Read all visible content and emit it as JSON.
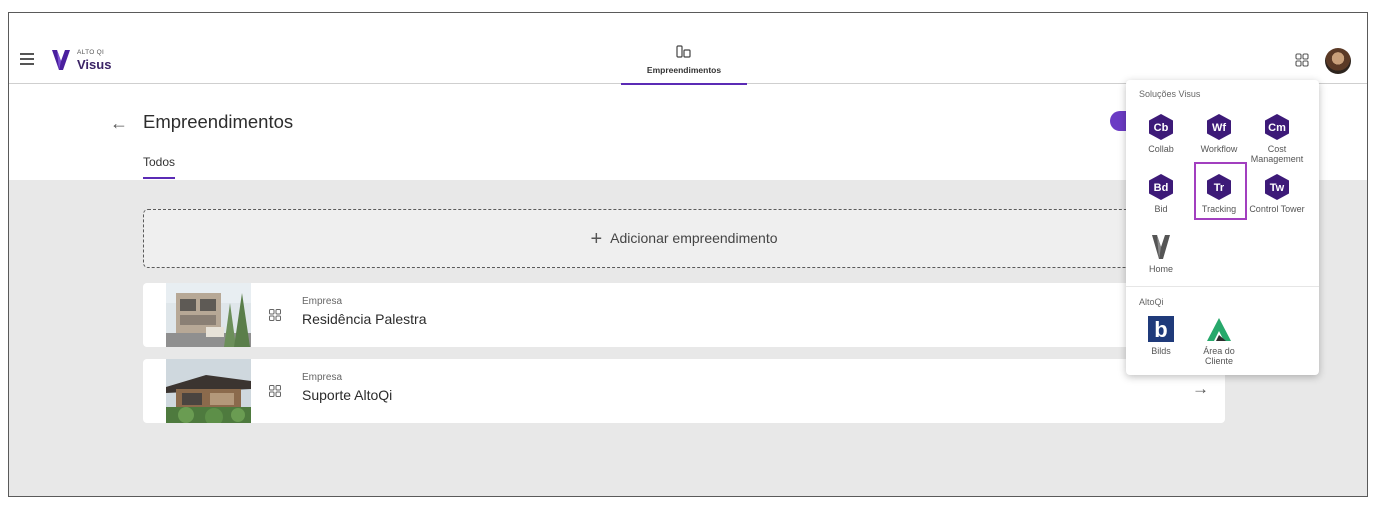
{
  "header": {
    "brand_small": "ALTO QI",
    "brand": "Visus",
    "nav_tab": "Empreendimentos"
  },
  "page": {
    "title": "Empreendimentos",
    "tab": "Todos"
  },
  "add_button_label": "Adicionar empreendimento",
  "projects": [
    {
      "label": "Empresa",
      "name": "Residência Palestra"
    },
    {
      "label": "Empresa",
      "name": "Suporte AltoQi"
    }
  ],
  "dropdown": {
    "section1": "Soluções Visus",
    "apps": [
      {
        "abbr": "Cb",
        "label": "Collab"
      },
      {
        "abbr": "Wf",
        "label": "Workflow"
      },
      {
        "abbr": "Cm",
        "label": "Cost Management"
      },
      {
        "abbr": "Bd",
        "label": "Bid"
      },
      {
        "abbr": "Tr",
        "label": "Tracking"
      },
      {
        "abbr": "Tw",
        "label": "Control Tower"
      },
      {
        "abbr": "",
        "label": "Home"
      }
    ],
    "section2": "AltoQi",
    "altoqi_apps": [
      {
        "abbr": "b",
        "label": "Bilds"
      },
      {
        "abbr": "",
        "label": "Área do Cliente"
      }
    ]
  },
  "colors": {
    "accent": "#5b2bb5",
    "hex_app": "#3d1a78",
    "highlight": "#a23fbf",
    "bilds": "#1f3a7a",
    "area_cliente": "#27a86b"
  }
}
